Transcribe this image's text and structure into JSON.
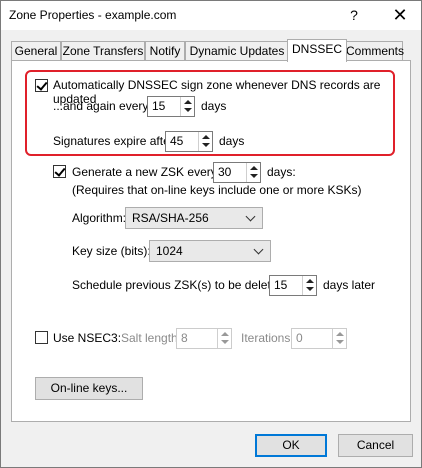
{
  "window": {
    "title": "Zone Properties - example.com",
    "help_glyph": "?",
    "close_glyph": "✕"
  },
  "tabs": [
    {
      "label": "General"
    },
    {
      "label": "Zone Transfers"
    },
    {
      "label": "Notify"
    },
    {
      "label": "Dynamic Updates"
    },
    {
      "label": "DNSSEC",
      "selected": true
    },
    {
      "label": "Comments"
    }
  ],
  "dnssec": {
    "auto_sign": {
      "label": "Automatically DNSSEC sign zone whenever DNS records are updated",
      "checked": true
    },
    "again_every": {
      "label": "...and again every:",
      "value": "15",
      "unit": "days"
    },
    "signatures_expire": {
      "label": "Signatures expire after:",
      "value": "45",
      "unit": "days"
    },
    "generate_zsk": {
      "label": "Generate a new ZSK every:",
      "checked": true,
      "value": "30",
      "unit": "days:"
    },
    "zsk_note": "(Requires that on-line keys include one or more KSKs)",
    "algorithm": {
      "label": "Algorithm:",
      "value": "RSA/SHA-256"
    },
    "key_size": {
      "label": "Key size (bits):",
      "value": "1024"
    },
    "schedule_delete": {
      "label": "Schedule previous ZSK(s) to be deleted:",
      "value": "15",
      "unit": "days later"
    },
    "nsec3": {
      "label": "Use NSEC3:",
      "checked": false,
      "salt_label": "Salt length:",
      "salt_value": "8",
      "iterations_label": "Iterations:",
      "iterations_value": "0"
    },
    "online_keys_button": "On-line keys..."
  },
  "footer": {
    "ok_label": "OK",
    "cancel_label": "Cancel"
  },
  "colors": {
    "highlight": "#e0202a",
    "default_button_border": "#0078d7"
  }
}
